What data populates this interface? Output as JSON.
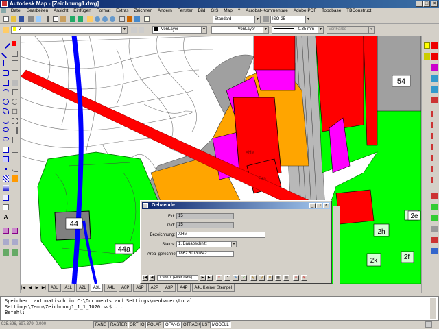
{
  "window": {
    "title": "Autodesk Map - [Zeichnung1.dwg]"
  },
  "menu": [
    "Datei",
    "Bearbeiten",
    "Ansicht",
    "Einfügen",
    "Format",
    "Extras",
    "Zeichnen",
    "Ändern",
    "Fenster",
    "Bild",
    "GIS",
    "Map",
    "?",
    "Acrobat-Kommentare",
    "Adobe PDF",
    "Topobase",
    "TBConstruct"
  ],
  "toolbar": {
    "text_style": "Standard",
    "dim_style": "ISO-25",
    "layer": "V",
    "color": "VonLayer",
    "linetype": "VonLayer",
    "lineweight": "0.35 mm",
    "plotstyle": "VonFarbe"
  },
  "map_labels": {
    "plot_54": "54",
    "plot_44": "44",
    "plot_44a": "44a",
    "plot_2e": "2e",
    "plot_2h": "2h",
    "plot_2k": "2k",
    "plot_2f": "2f",
    "bldg_xhm": "XHM",
    "bldg_pen": "Pen"
  },
  "layout_tabs": {
    "tabs": [
      "A0L",
      "A1L",
      "A2L",
      "A3L",
      "A4L",
      "A0P",
      "A1P",
      "A2P",
      "A3P",
      "A4P",
      "A4L Kleiner Stempel"
    ],
    "active_index": 3
  },
  "dialog": {
    "title": "Gebaeude",
    "fields": [
      {
        "label": "Fid:",
        "value": "15"
      },
      {
        "label": "Gid:",
        "value": "15"
      },
      {
        "label": "Bezeichnung:",
        "value": "XHM"
      },
      {
        "label": "Status:",
        "value": "1. Bauabschnitt"
      },
      {
        "label": "Area_gerechnet:",
        "value": "1862.50131842"
      }
    ],
    "record_text": "1 von 1 (Filter aktiv)"
  },
  "command_line": {
    "lines": [
      "Speichert automatisch in C:\\Documents and Settings\\neubauer\\Local",
      "Settings\\Temp\\Zeichnung1_1_1_1020.sv$ ...",
      "Befehl:"
    ]
  },
  "status_bar": {
    "coordinates": "925.696, 697.379, 0.000",
    "toggles": [
      "FANG",
      "RASTER",
      "ORTHO",
      "POLAR",
      "OFANG",
      "OTRACK",
      "LST",
      "MODELL"
    ],
    "active": [
      "OFANG",
      "MODELL"
    ]
  },
  "colors": {
    "brand": "#0a246a",
    "green": "#00ff00",
    "magenta": "#ff00ff",
    "red": "#ff0000",
    "orange": "#ffa500",
    "grey_building": "#808080",
    "blue_road": "#0000ff"
  }
}
